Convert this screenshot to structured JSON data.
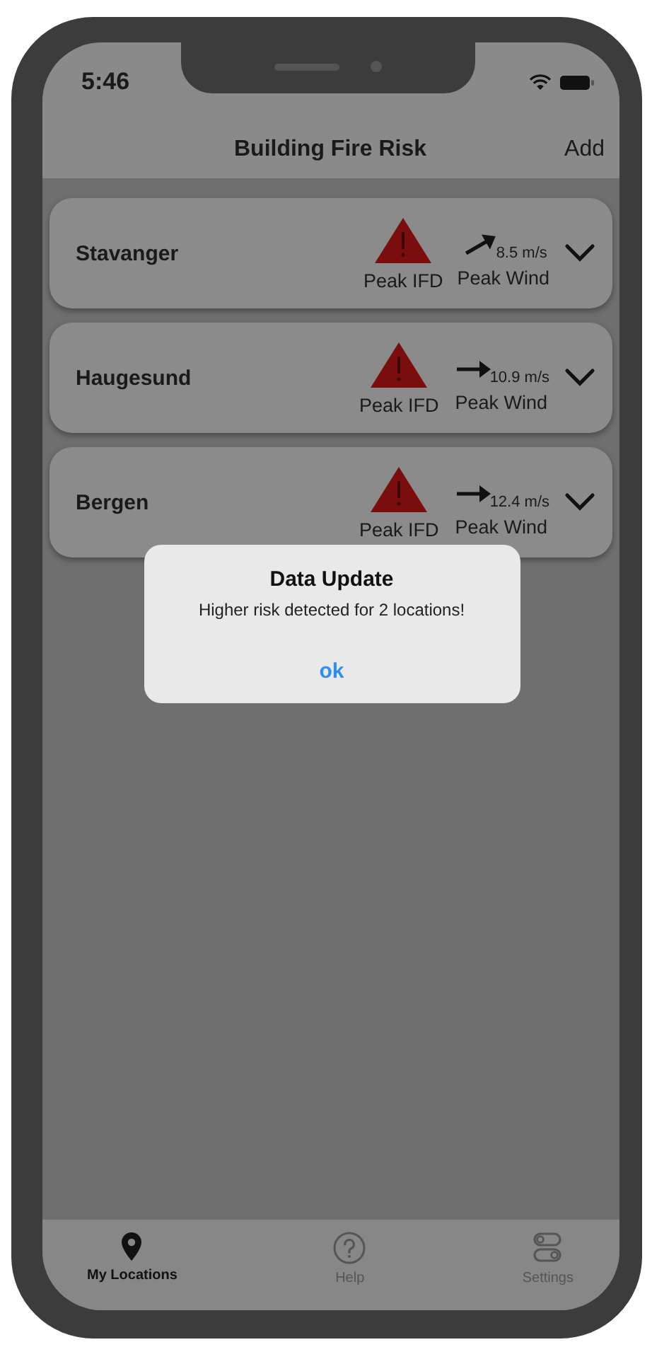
{
  "status_bar": {
    "time": "5:46"
  },
  "nav": {
    "title": "Building Fire Risk",
    "action": "Add"
  },
  "locations": [
    {
      "name": "Stavanger",
      "ifd_label": "Peak IFD",
      "wind": {
        "kind": "diagonal",
        "speed": "8.5 m/s",
        "label": "Peak Wind"
      },
      "expanded": false
    },
    {
      "name": "Haugesund",
      "ifd_label": "Peak IFD",
      "wind": {
        "kind": "level",
        "speed": "10.9 m/s",
        "label": "Peak Wind"
      },
      "expanded": false
    },
    {
      "name": "Bergen",
      "ifd_label": "Peak IFD",
      "wind": {
        "kind": "level",
        "speed": "12.4 m/s",
        "label": "Peak Wind"
      },
      "expanded": false
    }
  ],
  "alert": {
    "title": "Data Update",
    "message": "Higher risk detected for 2 locations!",
    "button": "ok"
  },
  "tab_bar": [
    {
      "label": "My Locations",
      "kind": "pin",
      "selected": true
    },
    {
      "label": "Help",
      "kind": "help",
      "selected": false
    },
    {
      "label": "Settings",
      "kind": "toggles",
      "selected": false
    }
  ]
}
